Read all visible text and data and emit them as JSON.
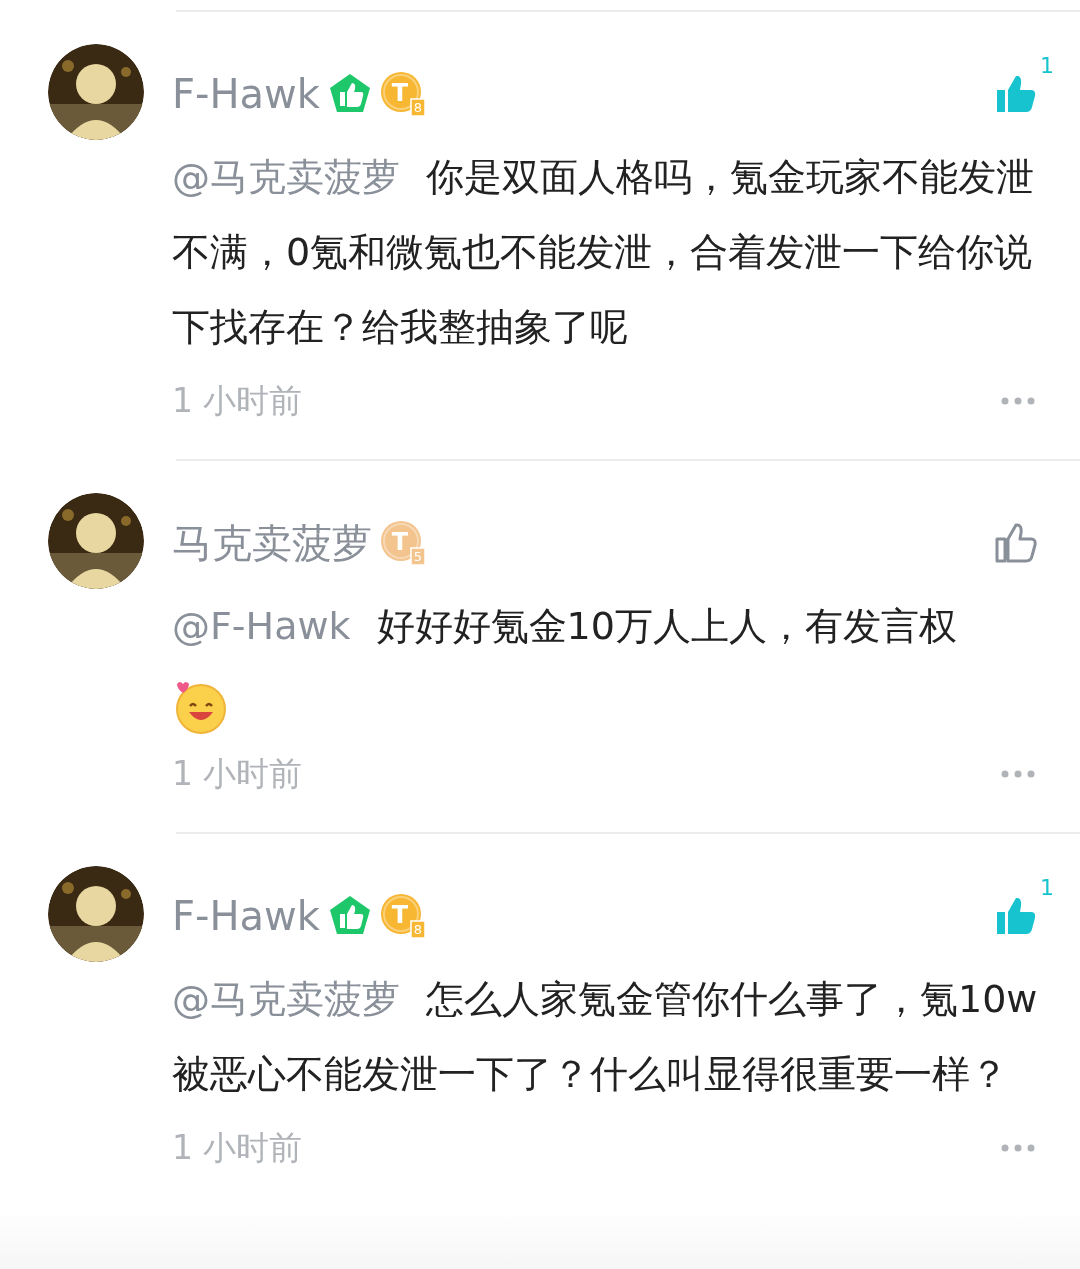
{
  "comments": [
    {
      "author": "F-Hawk",
      "verified": true,
      "rank_letter": "T",
      "rank_number": "8",
      "color": "#f7b733",
      "liked": true,
      "like_count": "1",
      "mention": "@马克卖菠萝",
      "text": "你是双面人格吗，氪金玩家不能发泄不满，0氪和微氪也不能发泄，合着发泄一下给你说下找存在？给我整抽象了呢",
      "emoji": false,
      "time": "1 小时前"
    },
    {
      "author": "马克卖菠萝",
      "verified": false,
      "rank_letter": "T",
      "rank_number": "5",
      "color": "#f3c48e",
      "liked": false,
      "mention": "@F-Hawk",
      "text": "好好好氪金10万人上人，有发言权",
      "emoji": true,
      "time": "1 小时前"
    },
    {
      "author": "F-Hawk",
      "verified": true,
      "rank_letter": "T",
      "rank_number": "8",
      "color": "#f7b733",
      "liked": true,
      "like_count": "1",
      "mention": "@马克卖菠萝",
      "text": "怎么人家氪金管你什么事了，氪10w被恶心不能发泄一下了？什么叫显得很重要一样？",
      "emoji": false,
      "time": "1 小时前"
    }
  ]
}
